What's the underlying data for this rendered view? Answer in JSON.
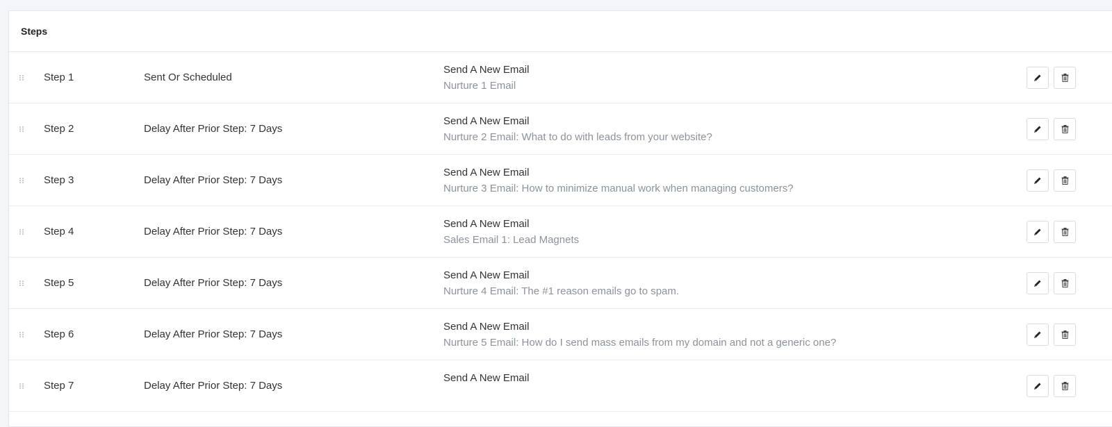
{
  "panel": {
    "title": "Steps"
  },
  "steps": [
    {
      "name": "Step 1",
      "delay": "Sent Or Scheduled",
      "action": "Send A New Email",
      "email": "Nurture 1 Email"
    },
    {
      "name": "Step 2",
      "delay": "Delay After Prior Step: 7 Days",
      "action": "Send A New Email",
      "email": "Nurture 2 Email: What to do with leads from your website?"
    },
    {
      "name": "Step 3",
      "delay": "Delay After Prior Step: 7 Days",
      "action": "Send A New Email",
      "email": "Nurture 3 Email: How to minimize manual work when managing customers?"
    },
    {
      "name": "Step 4",
      "delay": "Delay After Prior Step: 7 Days",
      "action": "Send A New Email",
      "email": "Sales Email 1: Lead Magnets"
    },
    {
      "name": "Step 5",
      "delay": "Delay After Prior Step: 7 Days",
      "action": "Send A New Email",
      "email": "Nurture 4 Email: The #1 reason emails go to spam."
    },
    {
      "name": "Step 6",
      "delay": "Delay After Prior Step: 7 Days",
      "action": "Send A New Email",
      "email": "Nurture 5 Email: How do I send mass emails from my domain and not a generic one?"
    },
    {
      "name": "Step 7",
      "delay": "Delay After Prior Step: 7 Days",
      "action": "Send A New Email",
      "email": ""
    }
  ],
  "icons": {
    "drag": "drag-handle-icon",
    "edit": "pencil-icon",
    "delete": "trash-icon"
  },
  "colors": {
    "text": "#333333",
    "muted": "#8a929c",
    "border": "#d9dce0",
    "background": "#f3f5f8"
  }
}
